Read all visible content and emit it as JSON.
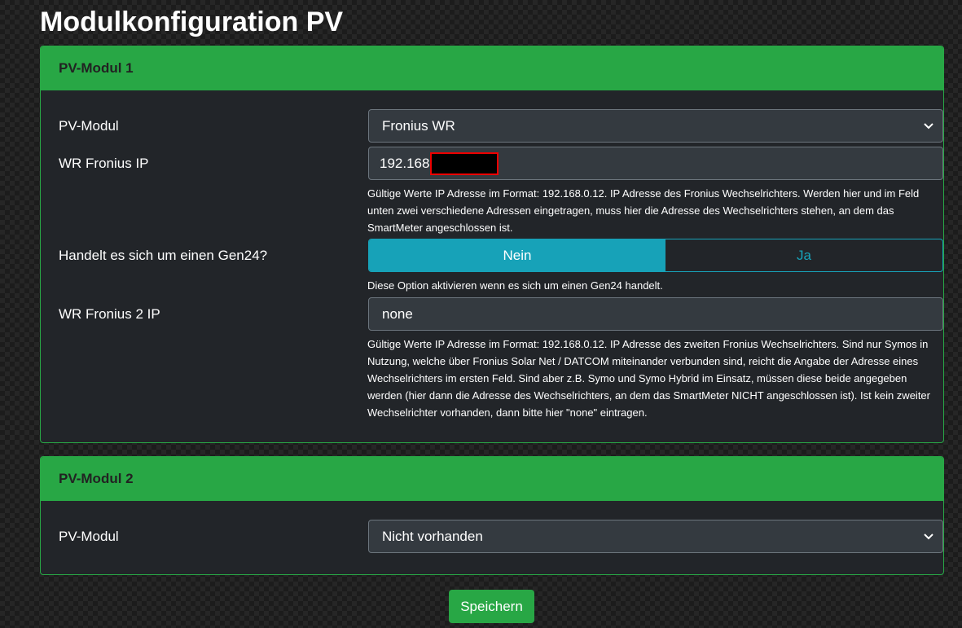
{
  "title": "Modulkonfiguration PV",
  "module1": {
    "header": "PV-Modul 1",
    "pv_modul_label": "PV-Modul",
    "pv_modul_value": "Fronius WR",
    "ip_label": "WR Fronius IP",
    "ip_value": "192.168",
    "ip_help": "Gültige Werte IP Adresse im Format: 192.168.0.12. IP Adresse des Fronius Wechselrichters. Werden hier und im Feld unten zwei verschiedene Adressen eingetragen, muss hier die Adresse des Wechselrichters stehen, an dem das SmartMeter angeschlossen ist.",
    "gen24_label": "Handelt es sich um einen Gen24?",
    "gen24_no": "Nein",
    "gen24_yes": "Ja",
    "gen24_help": "Diese Option aktivieren wenn es sich um einen Gen24 handelt.",
    "ip2_label": "WR Fronius 2 IP",
    "ip2_value": "none",
    "ip2_help": "Gültige Werte IP Adresse im Format: 192.168.0.12. IP Adresse des zweiten Fronius Wechselrichters. Sind nur Symos in Nutzung, welche über Fronius Solar Net / DATCOM miteinander verbunden sind, reicht die Angabe der Adresse eines Wechselrichters im ersten Feld. Sind aber z.B. Symo und Symo Hybrid im Einsatz, müssen diese beide angegeben werden (hier dann die Adresse des Wechselrichters, an dem das SmartMeter NICHT angeschlossen ist). Ist kein zweiter Wechselrichter vorhanden, dann bitte hier \"none\" eintragen."
  },
  "module2": {
    "header": "PV-Modul 2",
    "pv_modul_label": "PV-Modul",
    "pv_modul_value": "Nicht vorhanden"
  },
  "save_label": "Speichern",
  "colors": {
    "accent": "#28a745",
    "info": "#17a2b8"
  }
}
